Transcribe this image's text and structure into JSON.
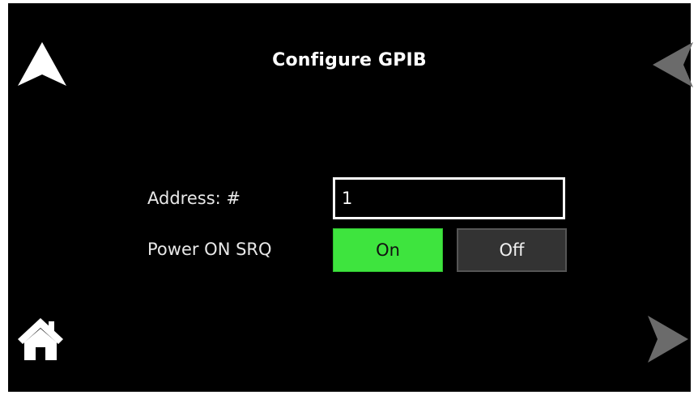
{
  "screen": {
    "title": "Configure GPIB"
  },
  "nav": {
    "up_icon": "up-arrow-icon",
    "back_icon": "left-arrow-icon",
    "home_icon": "home-icon",
    "forward_icon": "right-arrow-icon"
  },
  "form": {
    "address_label": "Address: #",
    "address_value": "1",
    "srq_label": "Power ON SRQ",
    "srq_options": [
      "On",
      "Off"
    ],
    "srq_selected": "On"
  },
  "colors": {
    "background": "#000000",
    "on_selected": "#3ee43e",
    "off_unselected": "#333333",
    "disabled_arrow": "#6b6b6b"
  }
}
